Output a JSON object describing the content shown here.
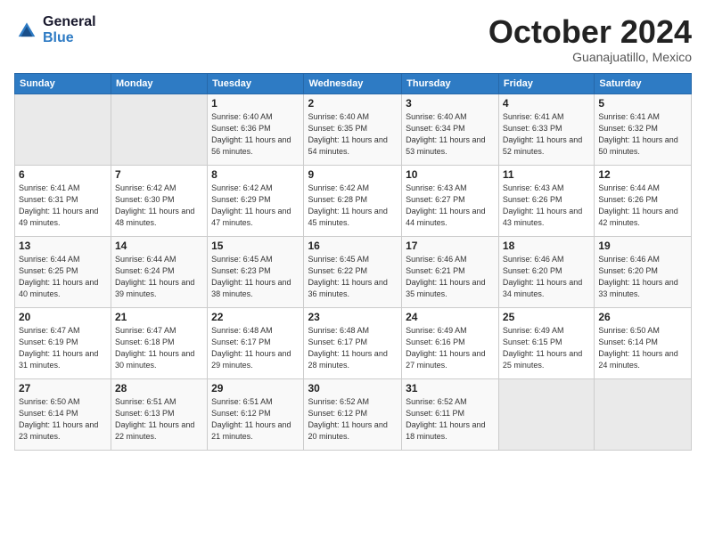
{
  "logo": {
    "text_general": "General",
    "text_blue": "Blue"
  },
  "header": {
    "month": "October 2024",
    "location": "Guanajuatillo, Mexico"
  },
  "weekdays": [
    "Sunday",
    "Monday",
    "Tuesday",
    "Wednesday",
    "Thursday",
    "Friday",
    "Saturday"
  ],
  "weeks": [
    [
      {
        "day": "",
        "info": ""
      },
      {
        "day": "",
        "info": ""
      },
      {
        "day": "1",
        "info": "Sunrise: 6:40 AM\nSunset: 6:36 PM\nDaylight: 11 hours and 56 minutes."
      },
      {
        "day": "2",
        "info": "Sunrise: 6:40 AM\nSunset: 6:35 PM\nDaylight: 11 hours and 54 minutes."
      },
      {
        "day": "3",
        "info": "Sunrise: 6:40 AM\nSunset: 6:34 PM\nDaylight: 11 hours and 53 minutes."
      },
      {
        "day": "4",
        "info": "Sunrise: 6:41 AM\nSunset: 6:33 PM\nDaylight: 11 hours and 52 minutes."
      },
      {
        "day": "5",
        "info": "Sunrise: 6:41 AM\nSunset: 6:32 PM\nDaylight: 11 hours and 50 minutes."
      }
    ],
    [
      {
        "day": "6",
        "info": "Sunrise: 6:41 AM\nSunset: 6:31 PM\nDaylight: 11 hours and 49 minutes."
      },
      {
        "day": "7",
        "info": "Sunrise: 6:42 AM\nSunset: 6:30 PM\nDaylight: 11 hours and 48 minutes."
      },
      {
        "day": "8",
        "info": "Sunrise: 6:42 AM\nSunset: 6:29 PM\nDaylight: 11 hours and 47 minutes."
      },
      {
        "day": "9",
        "info": "Sunrise: 6:42 AM\nSunset: 6:28 PM\nDaylight: 11 hours and 45 minutes."
      },
      {
        "day": "10",
        "info": "Sunrise: 6:43 AM\nSunset: 6:27 PM\nDaylight: 11 hours and 44 minutes."
      },
      {
        "day": "11",
        "info": "Sunrise: 6:43 AM\nSunset: 6:26 PM\nDaylight: 11 hours and 43 minutes."
      },
      {
        "day": "12",
        "info": "Sunrise: 6:44 AM\nSunset: 6:26 PM\nDaylight: 11 hours and 42 minutes."
      }
    ],
    [
      {
        "day": "13",
        "info": "Sunrise: 6:44 AM\nSunset: 6:25 PM\nDaylight: 11 hours and 40 minutes."
      },
      {
        "day": "14",
        "info": "Sunrise: 6:44 AM\nSunset: 6:24 PM\nDaylight: 11 hours and 39 minutes."
      },
      {
        "day": "15",
        "info": "Sunrise: 6:45 AM\nSunset: 6:23 PM\nDaylight: 11 hours and 38 minutes."
      },
      {
        "day": "16",
        "info": "Sunrise: 6:45 AM\nSunset: 6:22 PM\nDaylight: 11 hours and 36 minutes."
      },
      {
        "day": "17",
        "info": "Sunrise: 6:46 AM\nSunset: 6:21 PM\nDaylight: 11 hours and 35 minutes."
      },
      {
        "day": "18",
        "info": "Sunrise: 6:46 AM\nSunset: 6:20 PM\nDaylight: 11 hours and 34 minutes."
      },
      {
        "day": "19",
        "info": "Sunrise: 6:46 AM\nSunset: 6:20 PM\nDaylight: 11 hours and 33 minutes."
      }
    ],
    [
      {
        "day": "20",
        "info": "Sunrise: 6:47 AM\nSunset: 6:19 PM\nDaylight: 11 hours and 31 minutes."
      },
      {
        "day": "21",
        "info": "Sunrise: 6:47 AM\nSunset: 6:18 PM\nDaylight: 11 hours and 30 minutes."
      },
      {
        "day": "22",
        "info": "Sunrise: 6:48 AM\nSunset: 6:17 PM\nDaylight: 11 hours and 29 minutes."
      },
      {
        "day": "23",
        "info": "Sunrise: 6:48 AM\nSunset: 6:17 PM\nDaylight: 11 hours and 28 minutes."
      },
      {
        "day": "24",
        "info": "Sunrise: 6:49 AM\nSunset: 6:16 PM\nDaylight: 11 hours and 27 minutes."
      },
      {
        "day": "25",
        "info": "Sunrise: 6:49 AM\nSunset: 6:15 PM\nDaylight: 11 hours and 25 minutes."
      },
      {
        "day": "26",
        "info": "Sunrise: 6:50 AM\nSunset: 6:14 PM\nDaylight: 11 hours and 24 minutes."
      }
    ],
    [
      {
        "day": "27",
        "info": "Sunrise: 6:50 AM\nSunset: 6:14 PM\nDaylight: 11 hours and 23 minutes."
      },
      {
        "day": "28",
        "info": "Sunrise: 6:51 AM\nSunset: 6:13 PM\nDaylight: 11 hours and 22 minutes."
      },
      {
        "day": "29",
        "info": "Sunrise: 6:51 AM\nSunset: 6:12 PM\nDaylight: 11 hours and 21 minutes."
      },
      {
        "day": "30",
        "info": "Sunrise: 6:52 AM\nSunset: 6:12 PM\nDaylight: 11 hours and 20 minutes."
      },
      {
        "day": "31",
        "info": "Sunrise: 6:52 AM\nSunset: 6:11 PM\nDaylight: 11 hours and 18 minutes."
      },
      {
        "day": "",
        "info": ""
      },
      {
        "day": "",
        "info": ""
      }
    ]
  ]
}
